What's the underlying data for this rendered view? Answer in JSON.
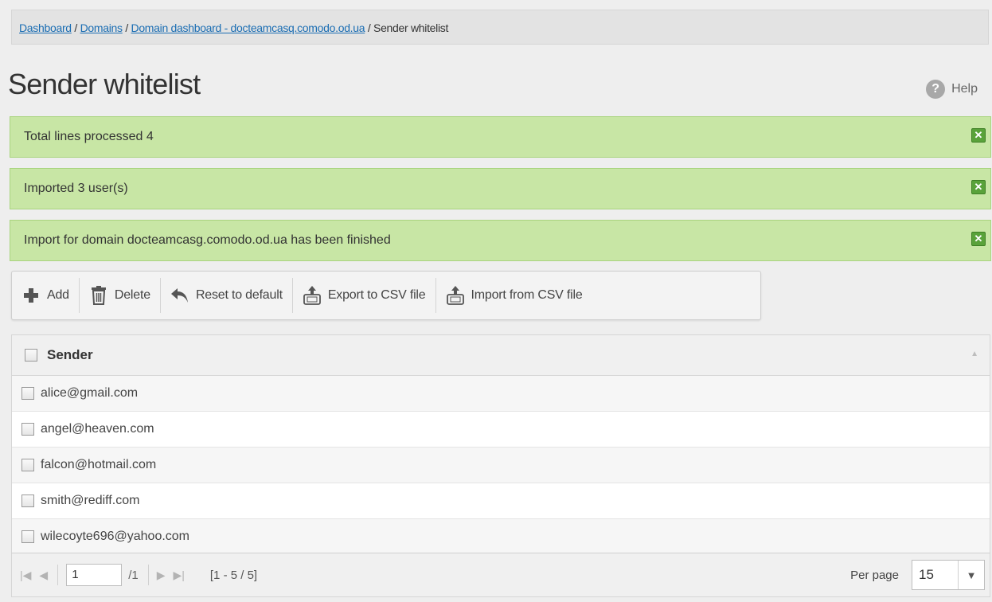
{
  "breadcrumb": {
    "items": [
      {
        "label": "Dashboard"
      },
      {
        "label": "Domains"
      },
      {
        "label": "Domain dashboard - docteamcasq.comodo.od.ua"
      }
    ],
    "separator": " / ",
    "current": "Sender whitelist"
  },
  "page": {
    "title": "Sender whitelist",
    "help_label": "Help"
  },
  "alerts": [
    {
      "text": "Total lines processed 4"
    },
    {
      "text": "Imported 3 user(s)"
    },
    {
      "text": "Import for domain docteamcasg.comodo.od.ua has been finished"
    }
  ],
  "toolbar": {
    "add_label": "Add",
    "delete_label": "Delete",
    "reset_label": "Reset to default",
    "export_label": "Export to CSV file",
    "import_label": "Import from CSV file"
  },
  "table": {
    "header": "Sender",
    "rows": [
      "alice@gmail.com",
      "angel@heaven.com",
      "falcon@hotmail.com",
      "smith@rediff.com",
      "wilecoyte696@yahoo.com"
    ]
  },
  "pager": {
    "page": "1",
    "total_pages": "/1",
    "range": "[1 - 5 / 5]",
    "per_page_label": "Per page",
    "per_page_value": "15"
  },
  "colors": {
    "alert_bg": "#c8e6a5",
    "alert_close": "#59a23a",
    "link": "#1a6db3"
  },
  "icons": [
    "help-icon",
    "close-icon",
    "add-icon",
    "trash-icon",
    "undo-icon",
    "export-csv-icon",
    "import-csv-icon",
    "first-page-icon",
    "prev-page-icon",
    "next-page-icon",
    "last-page-icon",
    "chevron-down-icon",
    "sort-icon"
  ]
}
